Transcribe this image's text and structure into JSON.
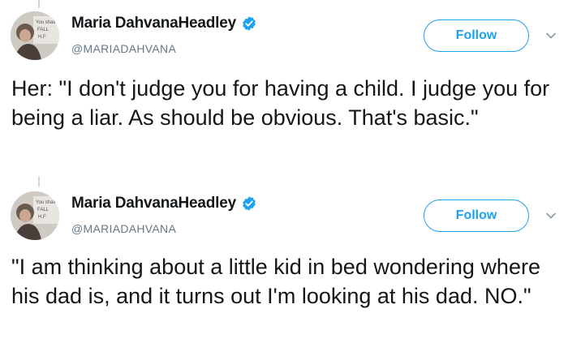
{
  "tweets": [
    {
      "author": {
        "name": "Maria DahvanaHeadley",
        "handle": "@MARIADAHVANA",
        "verified": true
      },
      "follow_label": "Follow",
      "text": "Her: \"I don't judge you for having a child. I judge you for being a liar. As should be obvious. That's basic.\""
    },
    {
      "author": {
        "name": "Maria DahvanaHeadley",
        "handle": "@MARIADAHVANA",
        "verified": true
      },
      "follow_label": "Follow",
      "text": "\"I am thinking about a little kid in bed wondering where his dad is, and it turns out I'm looking at his dad. NO.\""
    }
  ],
  "colors": {
    "accent": "#1da1f2",
    "text": "#14171a",
    "secondary": "#657786"
  },
  "icons": {
    "verified": "verified-badge-icon",
    "menu": "chevron-down-icon"
  }
}
